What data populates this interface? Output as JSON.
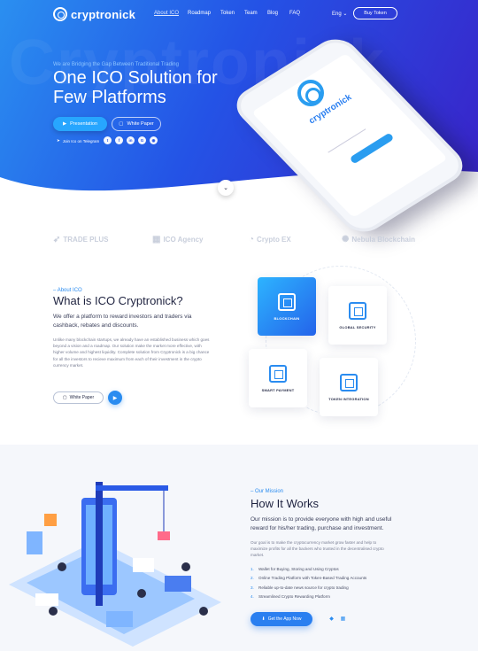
{
  "nav": {
    "logo": "cryptronick",
    "items": [
      "About ICO",
      "Roadmap",
      "Token",
      "Team",
      "Blog",
      "FAQ"
    ],
    "language": "Eng",
    "cta": "Buy Token"
  },
  "hero": {
    "kicker": "We are Bridging the Gap Between Traditional Trading",
    "headline_line1": "One ICO Solution for",
    "headline_line2": "Few Platforms",
    "btn_presentation": "Presentation",
    "btn_whitepaper": "White Paper",
    "telegram": "Join Ico on Telegram",
    "socials": [
      "twitter-icon",
      "facebook-icon",
      "linkedin-icon",
      "google-plus-icon",
      "github-icon"
    ],
    "ghost_text": "Cryptronick",
    "phone_brand": "cryptronick"
  },
  "partners": [
    "TRADE PLUS",
    "ICO Agency",
    "Crypto EX",
    "Nebula Blockchain"
  ],
  "about": {
    "kicker": "About ICO",
    "title": "What is ICO Cryptronick?",
    "lead": "We offer a platform to reward investors and traders via cashback, rebates and discounts.",
    "body": "Unlike many blockchain startups, we already have an established business which goes beyond a vision and a roadmap. Our solution make the market more effective, with higher volume and highest liquidity. Complete solution from Cryptronick is a big chance for all the investors to recieve maximum from each of their investment in the crypto currency market.",
    "btn_whitepaper": "White Paper",
    "features": [
      "BLOCKCHAIN",
      "GLOBAL SECURITY",
      "SMART PAYMENT",
      "TOKEN INTEGRATION"
    ]
  },
  "how": {
    "kicker": "Our Mission",
    "title": "How It Works",
    "lead": "Our mission is to provide everyone with high and useful reward for his/her trading, purchase and investment.",
    "body": "Our goal is to make the cryptocurrency market grow faster and help to maximize profits for all the backers who trusted in the decentralised crypto market.",
    "steps": [
      {
        "n": "1.",
        "text": "Wallet for Buying, Storing and Using Cryptos"
      },
      {
        "n": "2.",
        "text": "Online Trading Platform with Token-Based Trading Accounts"
      },
      {
        "n": "3.",
        "text": "Reliable up-to-date news source for crypto trading"
      },
      {
        "n": "4.",
        "text": "Streamlined Crypto Rewarding Platform"
      }
    ],
    "btn_app": "Get the App Now"
  },
  "colors": {
    "accent": "#2a8cf0",
    "hero_start": "#2a8ff0",
    "hero_end": "#3a22c8",
    "section_bg": "#f5f7fb"
  }
}
